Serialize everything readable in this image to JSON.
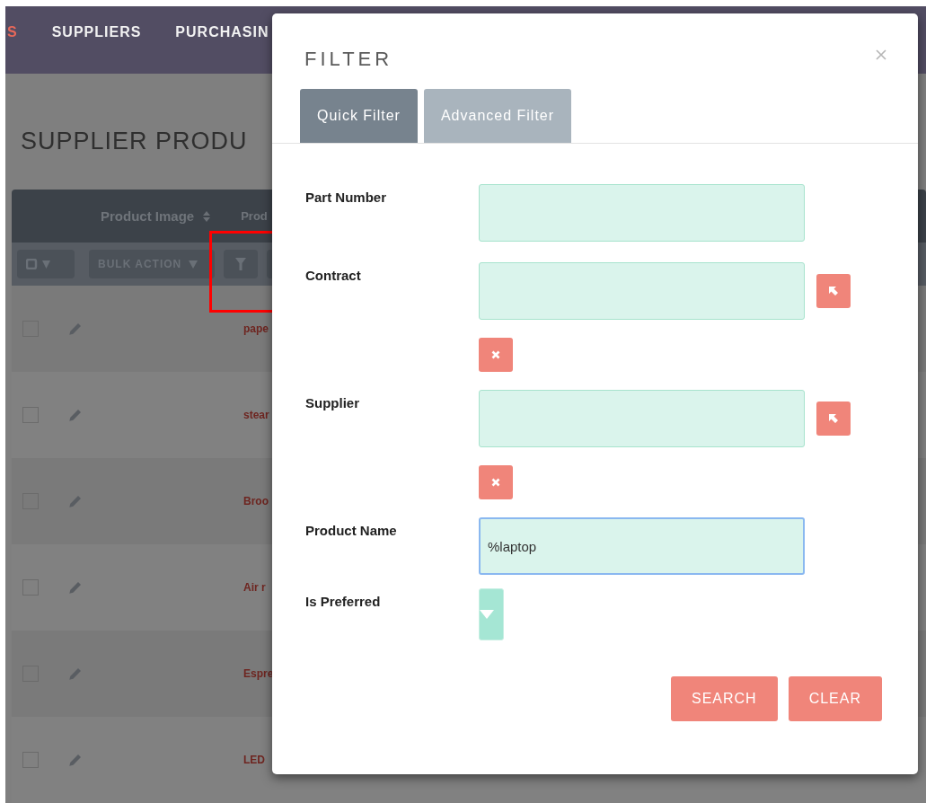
{
  "nav": [
    {
      "label": "S",
      "selected": true
    },
    {
      "label": "SUPPLIERS",
      "selected": false
    },
    {
      "label": "PURCHASIN",
      "selected": false
    }
  ],
  "page_title": "SUPPLIER PRODU",
  "table": {
    "columns": [
      "Product Image",
      "Prod"
    ],
    "bulk_action": "BULK ACTION",
    "rows": [
      {
        "name": "pape",
        "checked": false
      },
      {
        "name": "stear",
        "checked": false
      },
      {
        "name": "Broo",
        "checked": false
      },
      {
        "name": "Air r",
        "checked": false
      },
      {
        "name": "Espre",
        "checked": false
      },
      {
        "name": "LED",
        "checked": false
      }
    ]
  },
  "filter_dialog": {
    "title": "FILTER",
    "tabs": [
      {
        "label": "Quick Filter",
        "selected": true
      },
      {
        "label": "Advanced Filter",
        "selected": false
      }
    ],
    "fields": [
      {
        "kind": "text",
        "label": "Part Number",
        "focused": false
      },
      {
        "kind": "relate",
        "label": "Contract",
        "focused": false
      },
      {
        "kind": "relate",
        "label": "Supplier",
        "focused": false
      },
      {
        "kind": "text",
        "label": "Product Name",
        "value": "%laptop",
        "focused": true
      },
      {
        "kind": "select",
        "label": "Is Preferred",
        "focused": false
      }
    ],
    "buttons": [
      "SEARCH",
      "CLEAR"
    ]
  }
}
